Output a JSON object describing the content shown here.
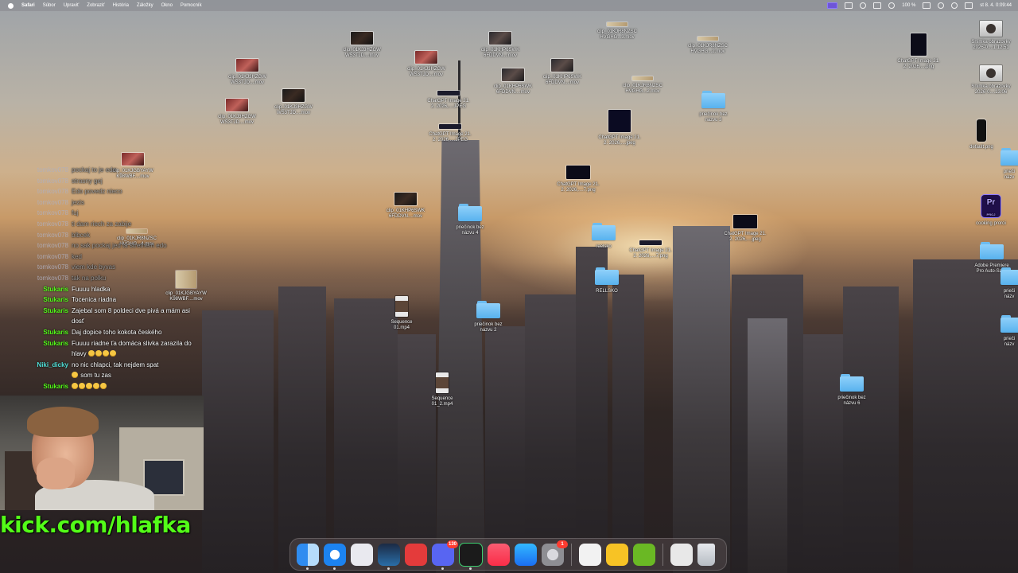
{
  "menubar": {
    "app": "Safari",
    "items": [
      "Súbor",
      "Upraviť",
      "Zobraziť",
      "História",
      "Záložky",
      "Okno",
      "Pomocník"
    ],
    "battery": "100 %",
    "clock": "st 8. 4.  0:09:44",
    "status_icons": [
      "screen-record-icon",
      "control-center-icon",
      "wifi-icon",
      "bluetooth-icon",
      "sound-icon",
      "battery-icon",
      "user-icon",
      "search-icon",
      "siri-icon"
    ]
  },
  "desktop": [
    {
      "kind": "video",
      "label": "clip_01KJ3HZGW\nWS3TJD....mov"
    },
    {
      "kind": "video",
      "label": "clip_01KJ3HZGW\nWS3TJD....mov"
    },
    {
      "kind": "video",
      "label": "clip_01KJ3HZGW\nWS3TJD....mov"
    },
    {
      "kind": "video",
      "label": "clip_01KHP6SWK\n6FDDVN....mov"
    },
    {
      "kind": "video",
      "label": "clip_01KHP6SWK\n6FDDVN....mov"
    },
    {
      "kind": "video",
      "label": "clip_01KHP6SWK\n6FDDVN....mov"
    },
    {
      "kind": "video",
      "label": "clip_01KJR8NZSC\nHVGHG...3.mov"
    },
    {
      "kind": "video",
      "label": "clip_01KJR8NZSC\nHVGHG...2.mov"
    },
    {
      "kind": "video",
      "label": "clip_01KJR8NZSC\nHVGHG...2.mov"
    },
    {
      "kind": "video",
      "label": "clip_01KJ3HZGW\nWS3TJD....mov"
    },
    {
      "kind": "video",
      "label": "clip_01KJ3HZGW\nWS3TJD....mov"
    },
    {
      "kind": "video",
      "label": "clip_01KHP6SWK\n6FDDVN....mov"
    },
    {
      "kind": "video",
      "label": "clip_01KJGBYAYW\nK98WBF....mov"
    },
    {
      "kind": "video",
      "label": "clip_01KJGBYAYW\nK98WBF....mov"
    },
    {
      "kind": "video",
      "label": "clip_01KJR8NZSC\nHVGHG...4.mov"
    },
    {
      "kind": "image",
      "label": "ChatGPT Image 21.\n2. 2026,....JPEG"
    },
    {
      "kind": "image",
      "label": "ChatGPT Image 21.\n2. 2026,....jpeg"
    },
    {
      "kind": "image",
      "label": "ChatGPT Image 21.\n2. 2026,....7.png"
    },
    {
      "kind": "image",
      "label": "ChatGPT Image 21.\n2. 2026,....png"
    },
    {
      "kind": "image",
      "label": "ChatGPT Image 21.\n2. 2026,....jpeg"
    },
    {
      "kind": "image",
      "label": "ChatGPT Image 21.\n2. 2026,....7.png"
    },
    {
      "kind": "folder",
      "label": "priečinok bez\nnázvu 4"
    },
    {
      "kind": "folder",
      "label": "priečinok bez\nnázvu 3"
    },
    {
      "kind": "folder",
      "label": "priečinok bez\nnázvu 2"
    },
    {
      "kind": "folder",
      "label": "priečinok bez\nnázvu 6"
    },
    {
      "kind": "folder",
      "label": "RELLSKO"
    },
    {
      "kind": "folder",
      "label": "reelsko"
    },
    {
      "kind": "video",
      "label": "Sequence\n01.mp4"
    },
    {
      "kind": "video",
      "label": "Sequence\n01_2.mp4"
    },
    {
      "kind": "image",
      "label": "Snímka obrazovky\n2026-0....1.12.51"
    },
    {
      "kind": "image",
      "label": "Snímka obrazovky\n2026-0....13.06"
    },
    {
      "kind": "image",
      "label": "default.png"
    },
    {
      "kind": "app",
      "label": "cooking proroi",
      "badge": "Pr",
      "sub": "PROJ"
    },
    {
      "kind": "folder",
      "label": "Adobe Premiere\nPro Auto-Save"
    },
    {
      "kind": "folder",
      "label": "prieči\nnázv"
    },
    {
      "kind": "folder",
      "label": "prieči\nnázv"
    },
    {
      "kind": "folder",
      "label": "prieči\nnázv"
    }
  ],
  "chat": [
    {
      "user": "tomkov078",
      "msg": "pockaj to je edo",
      "style": "faded"
    },
    {
      "user": "tomkov078",
      "msg": "strasny gej",
      "style": "faded"
    },
    {
      "user": "tomkov078",
      "msg": "Edo povedz nieco",
      "style": "faded"
    },
    {
      "user": "tomkov078",
      "msg": "jezis",
      "style": "faded"
    },
    {
      "user": "tomkov078",
      "msg": "fuj",
      "style": "faded"
    },
    {
      "user": "tomkov078",
      "msg": "ti dam riech za zabije",
      "style": "faded"
    },
    {
      "user": "tomkov078",
      "msg": "blbcek",
      "style": "faded"
    },
    {
      "user": "tomkov078",
      "msg": "no sak pockaj jed ta stretnem edo",
      "style": "faded"
    },
    {
      "user": "tomkov078",
      "msg": "ked",
      "style": "faded"
    },
    {
      "user": "tomkov078",
      "msg": "viem kde byvas",
      "style": "faded"
    },
    {
      "user": "tomkov078",
      "msg": "tak na polku",
      "style": "faded"
    },
    {
      "user": "Stukaris",
      "msg": "Fuuuu hladka",
      "style": "green"
    },
    {
      "user": "Stukaris",
      "msg": "Tocenica riadna",
      "style": "green"
    },
    {
      "user": "Stukaris",
      "msg": "Zajebal som 8 poldeci dve pivá a mám asi dosť",
      "style": "green"
    },
    {
      "user": "Stukaris",
      "msg": "Daj dopice toho kokota českého",
      "style": "green"
    },
    {
      "user": "Stukaris",
      "msg": "Fuuuu riadne ťa domáca slivka zarazila do hlavy",
      "emotes": 4,
      "style": "green"
    },
    {
      "user": "Niki_dicky",
      "msg": "no nic chlapci, tak nejdem spat",
      "msg2": "som tu zas",
      "emotes2": 1,
      "style": "cyan"
    },
    {
      "user": "Stukaris",
      "msg": "",
      "emotes": 5,
      "style": "green"
    }
  ],
  "stream": {
    "url": "kick.com/hlafka"
  },
  "dock": [
    {
      "name": "finder-icon",
      "color": "#2f8cf0"
    },
    {
      "name": "safari-icon",
      "color": "#1c83f0"
    },
    {
      "name": "launchpad-icon",
      "color": "#e9e9ef"
    },
    {
      "name": "steam-icon",
      "color": "#1b2a44"
    },
    {
      "name": "mcdonalds-icon",
      "color": "#e43b3b"
    },
    {
      "name": "discord-icon",
      "color": "#5865f2",
      "badge": "130"
    },
    {
      "name": "cleanshot-icon",
      "color": "#1b1b1b"
    },
    {
      "name": "music-icon",
      "color": "#fa2d48"
    },
    {
      "name": "app-store-icon",
      "color": "#1b8ff2"
    },
    {
      "name": "system-settings-icon",
      "color": "#8e8e93",
      "badge": "1"
    },
    {
      "name": "notes-icon",
      "color": "#f2f2f2"
    },
    {
      "name": "tips-icon",
      "color": "#f7c325"
    },
    {
      "name": "nvidia-icon",
      "color": "#6ab824"
    },
    {
      "name": "downloads-stack-icon",
      "color": "#e8e8e8"
    },
    {
      "name": "trash-icon",
      "color": "#cfd4da"
    }
  ]
}
